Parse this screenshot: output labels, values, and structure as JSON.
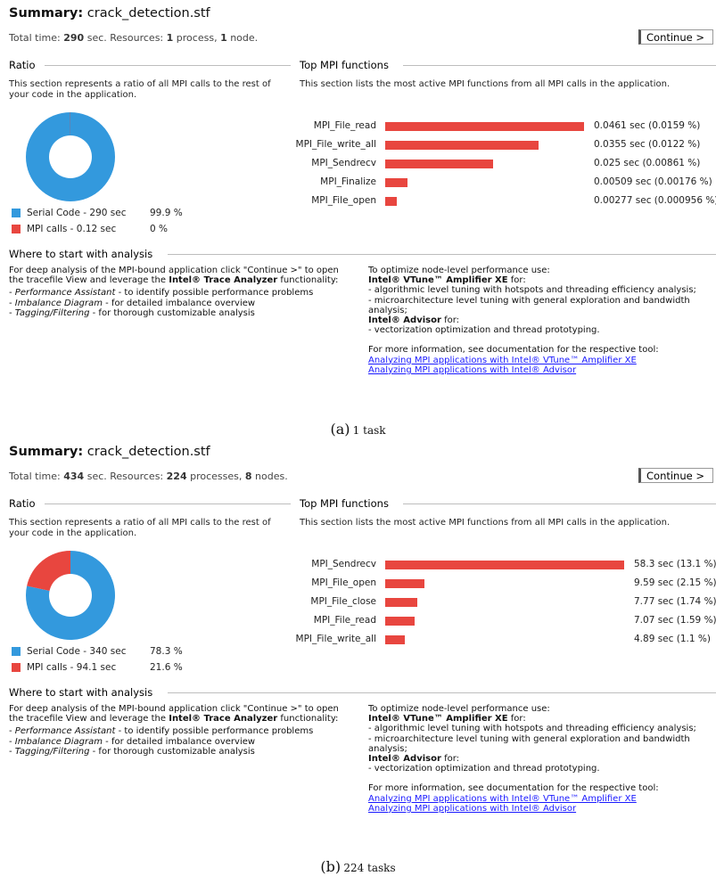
{
  "panels": [
    {
      "summary_label": "Summary:",
      "file_name": "crack_detection.stf",
      "meta": {
        "prefix": "Total time: ",
        "time": "290",
        "mid": " sec. Resources: ",
        "processes": "1",
        "proc_word": " process, ",
        "nodes": "1",
        "node_word": " node."
      },
      "continue_label": "Continue >",
      "ratio_heading": "Ratio",
      "ratio_desc_1": "This section represents a ratio of all MPI calls to the rest of",
      "ratio_desc_2": "your code in the application.",
      "top_heading": "Top MPI functions",
      "top_desc": "This section lists the most active MPI functions from all MPI calls in the application.",
      "where_heading": "Where to start with analysis",
      "chart_data": {
        "type": "bar",
        "categories": [
          "MPI_File_read",
          "MPI_File_write_all",
          "MPI_Sendrecv",
          "MPI_Finalize",
          "MPI_File_open"
        ],
        "values": [
          0.0461,
          0.0355,
          0.025,
          0.00509,
          0.00277
        ],
        "value_labels": [
          "0.0461 sec (0.0159 %)",
          "0.0355 sec (0.0122 %)",
          "0.025 sec (0.00861 %)",
          "0.00509 sec (0.00176 %)",
          "0.00277 sec (0.000956 %)"
        ],
        "bar_color": "#e8463f"
      },
      "ratio_chart": {
        "type": "pie",
        "slices": [
          {
            "label": "Serial Code - 290 sec",
            "percent_label": "99.9 %",
            "value": 99.9,
            "color": "#3399dd"
          },
          {
            "label": "MPI calls - 0.12 sec",
            "percent_label": "0 %",
            "value": 0.1,
            "color": "#e8463f"
          }
        ]
      },
      "caption_letter": "(a)",
      "caption_text": "1 task"
    },
    {
      "summary_label": "Summary:",
      "file_name": "crack_detection.stf",
      "meta": {
        "prefix": "Total time: ",
        "time": "434",
        "mid": " sec. Resources: ",
        "processes": "224",
        "proc_word": " processes, ",
        "nodes": "8",
        "node_word": " nodes."
      },
      "continue_label": "Continue >",
      "ratio_heading": "Ratio",
      "ratio_desc_1": "This section represents a ratio of all MPI calls to the rest of",
      "ratio_desc_2": "your code in the application.",
      "top_heading": "Top MPI functions",
      "top_desc": "This section lists the most active MPI functions from all MPI calls in the application.",
      "where_heading": "Where to start with analysis",
      "chart_data": {
        "type": "bar",
        "categories": [
          "MPI_Sendrecv",
          "MPI_File_open",
          "MPI_File_close",
          "MPI_File_read",
          "MPI_File_write_all"
        ],
        "values": [
          58.3,
          9.59,
          7.77,
          7.07,
          4.89
        ],
        "value_labels": [
          "58.3 sec (13.1 %)",
          "9.59 sec (2.15 %)",
          "7.77 sec (1.74 %)",
          "7.07 sec (1.59 %)",
          "4.89 sec (1.1 %)"
        ],
        "bar_color": "#e8463f"
      },
      "ratio_chart": {
        "type": "pie",
        "slices": [
          {
            "label": "Serial Code - 340 sec",
            "percent_label": "78.3 %",
            "value": 78.3,
            "color": "#3399dd"
          },
          {
            "label": "MPI calls - 94.1 sec",
            "percent_label": "21.6 %",
            "value": 21.6,
            "color": "#e8463f"
          }
        ]
      },
      "caption_letter": "(b)",
      "caption_text": "224 tasks"
    }
  ],
  "analysis": {
    "left_1": "For deep analysis of the MPI-bound application click \"Continue >\" to open",
    "left_2a": "the tracefile View and leverage the ",
    "left_2b": "Intel® Trace Analyzer",
    "left_2c": " functionality:",
    "pa_name": "Performance Assistant",
    "pa_desc": " - to identify possible performance problems",
    "id_name": "Imbalance Diagram",
    "id_desc": " - for detailed imbalance overview",
    "tf_name": "Tagging/Filtering",
    "tf_desc": " - for thorough customizable analysis",
    "right_1": "To optimize node-level performance use:",
    "vtune_name": "Intel® VTune™ Amplifier XE",
    "for_word": " for:",
    "vtune_1": "- algorithmic level tuning with hotspots and threading efficiency analysis;",
    "vtune_2": "- microarchitecture level tuning with general exploration and bandwidth",
    "vtune_3": "analysis;",
    "advisor_name": "Intel® Advisor",
    "advisor_1": "- vectorization optimization and thread prototyping.",
    "more_info": "For more information, see documentation for the respective tool:",
    "link_vtune": "Analyzing MPI applications with Intel® VTune™ Amplifier XE",
    "link_advisor": "Analyzing MPI applications with Intel® Advisor"
  }
}
